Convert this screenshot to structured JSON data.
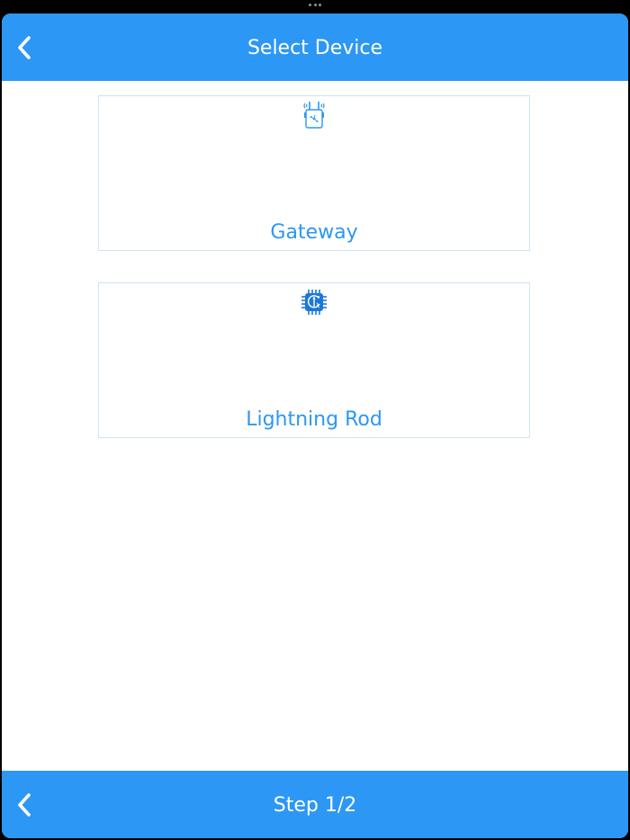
{
  "header": {
    "title": "Select Device",
    "back_icon": "chevron-left-icon"
  },
  "devices": [
    {
      "label": "Gateway",
      "icon": "gateway-router-icon"
    },
    {
      "label": "Lightning Rod",
      "icon": "lightning-rod-chip-icon"
    }
  ],
  "footer": {
    "step_label": "Step 1/2",
    "back_icon": "chevron-left-icon"
  },
  "colors": {
    "accent": "#2c97f4",
    "card_border": "#cfe3f7",
    "background": "#ffffff"
  }
}
